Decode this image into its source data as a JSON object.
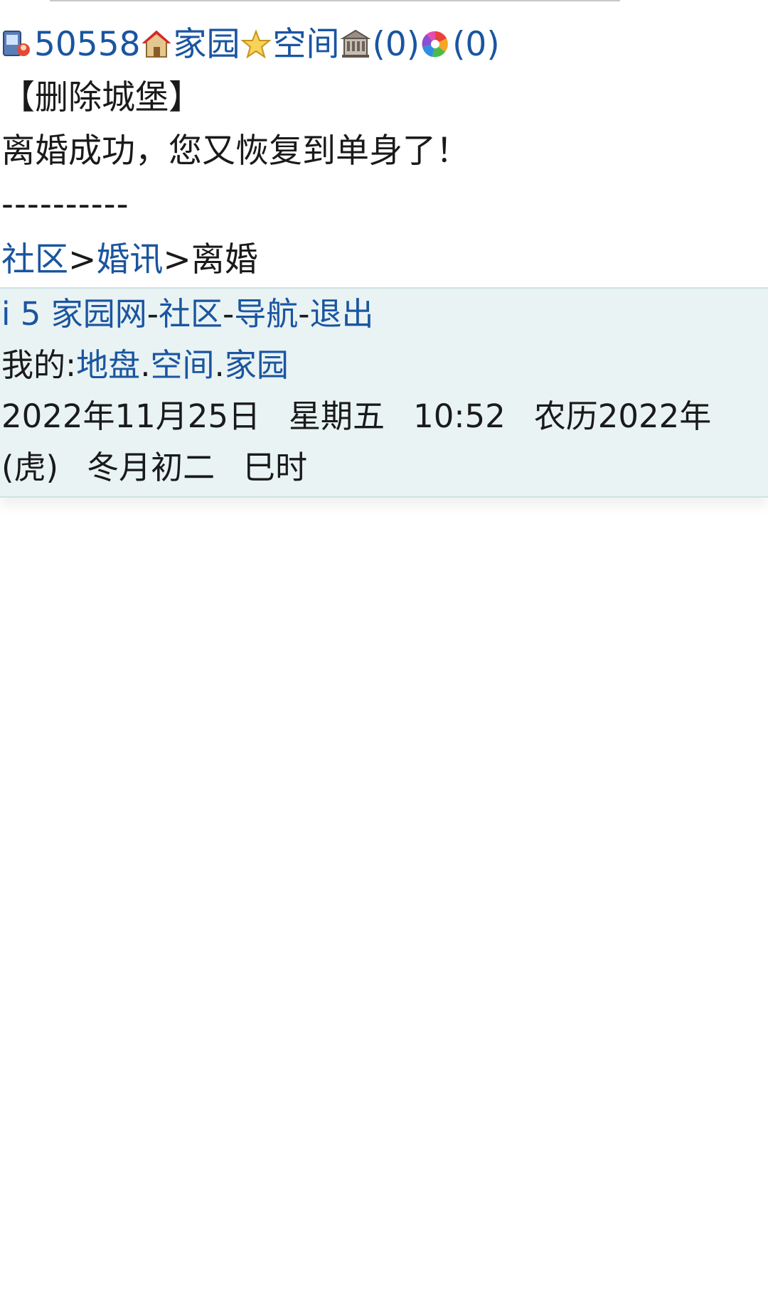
{
  "header": {
    "user_id": "50558",
    "home_label": "家园",
    "space_label": "空间",
    "castle_count": "(0)",
    "photo_count": "(0)"
  },
  "actions": {
    "delete_castle": "【删除城堡】"
  },
  "message": {
    "text": "离婚成功，您又恢复到单身了！",
    "separator": "----------"
  },
  "breadcrumb": {
    "items": [
      {
        "label": "社区"
      },
      {
        "label": "婚讯"
      },
      {
        "label": "离婚"
      }
    ],
    "separator": ">"
  },
  "footer": {
    "nav": {
      "items": [
        {
          "label": "i 5 家园网"
        },
        {
          "label": "社区"
        },
        {
          "label": "导航"
        },
        {
          "label": "退出"
        }
      ],
      "separator": "-"
    },
    "mine": {
      "prefix": "我的:",
      "items": [
        {
          "label": "地盘"
        },
        {
          "label": "空间"
        },
        {
          "label": "家园"
        }
      ],
      "separator": "."
    },
    "datetime": {
      "date": "2022年11月25日",
      "weekday": "星期五",
      "time": "10:52",
      "lunar_year": "农历2022年",
      "zodiac": "(虎)",
      "lunar_day": "冬月初二",
      "shichen": "巳时"
    }
  },
  "colors": {
    "link": "#1a55a0",
    "text": "#1a1a1a",
    "footer_bg": "#e9f3f3"
  },
  "icons": [
    "user-phone-icon",
    "home-icon",
    "star-icon",
    "castle-icon",
    "photo-wheel-icon"
  ]
}
